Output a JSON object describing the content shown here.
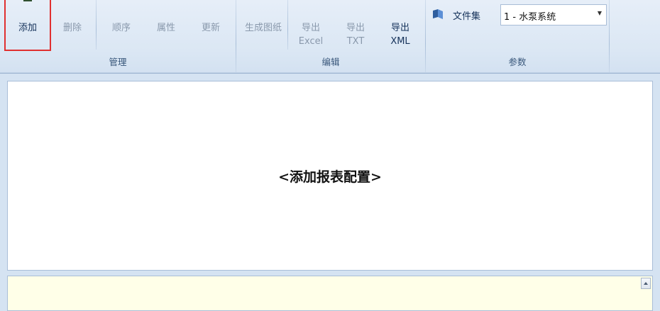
{
  "ribbon": {
    "groups": {
      "manage": {
        "label": "管理",
        "buttons": {
          "add": "添加",
          "delete": "删除",
          "order": "顺序",
          "properties": "属性",
          "update": "更新"
        }
      },
      "edit": {
        "label": "编辑",
        "buttons": {
          "generate_drawing": "生成图纸",
          "export_excel_1": "导出",
          "export_excel_2": "Excel",
          "export_txt_1": "导出",
          "export_txt_2": "TXT",
          "export_xml_1": "导出",
          "export_xml_2": "XML"
        }
      },
      "params": {
        "label": "参数",
        "fileset_label": "文件集",
        "fileset_value": "1 - 水泵系统"
      }
    }
  },
  "main": {
    "placeholder": "<添加报表配置>"
  },
  "colors": {
    "selected_border": "#e03030",
    "ribbon_bg": "#dbe7f4",
    "bottom_panel_bg": "#ffffe8"
  }
}
